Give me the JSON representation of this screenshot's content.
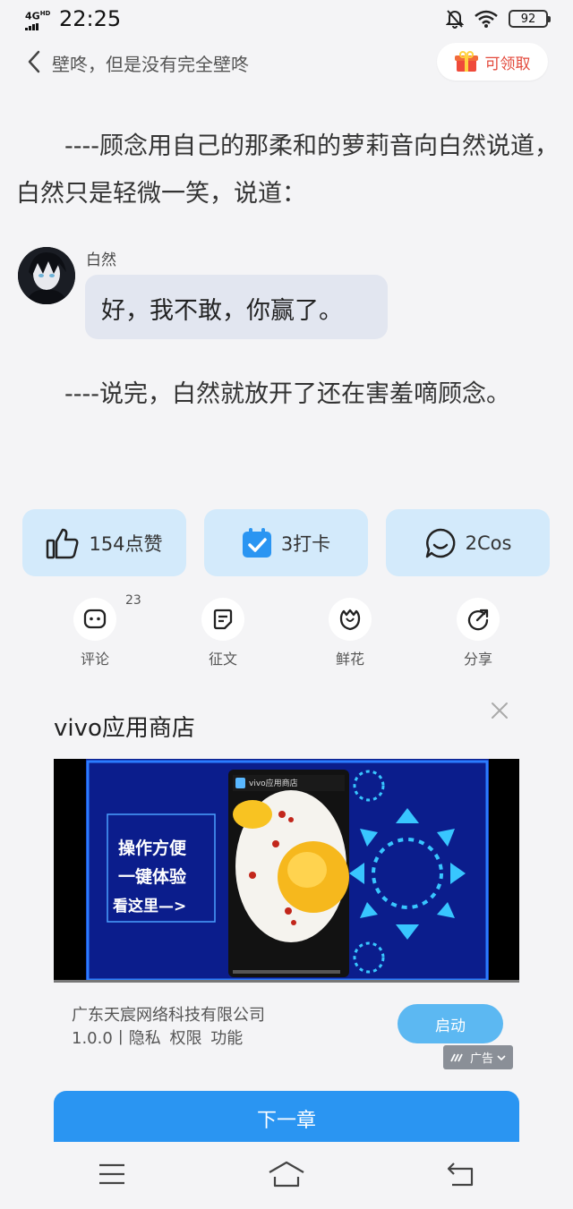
{
  "status": {
    "network": "4G",
    "network_sup": "HD",
    "time": "22:25",
    "battery": "92"
  },
  "header": {
    "title": "壁咚，但是没有完全壁咚",
    "reward_label": "可领取"
  },
  "story": {
    "paragraph1": "　　----顾念用自己的那柔和的萝莉音向白然说道，白然只是轻微一笑，说道：",
    "speaker": "白然",
    "dialogue": "好，我不敢，你赢了。",
    "paragraph2": "　　----说完，白然就放开了还在害羞嘀顾念。"
  },
  "actions": {
    "like": "154点赞",
    "checkin": "3打卡",
    "cos": "2Cos"
  },
  "tools": {
    "comment_label": "评论",
    "comment_count": "23",
    "essay_label": "征文",
    "flower_label": "鲜花",
    "share_label": "分享"
  },
  "ad": {
    "title": "vivo应用商店",
    "media": {
      "app_label": "vivo应用商店",
      "line1": "操作方便",
      "line2": "一键体验",
      "line3": "看这里—>"
    },
    "company": "广东天宸网络科技有限公司",
    "meta": "1.0.0丨隐私 权限 功能",
    "launch_label": "启动",
    "ad_tag": "广告"
  },
  "next_chapter_label": "下一章"
}
